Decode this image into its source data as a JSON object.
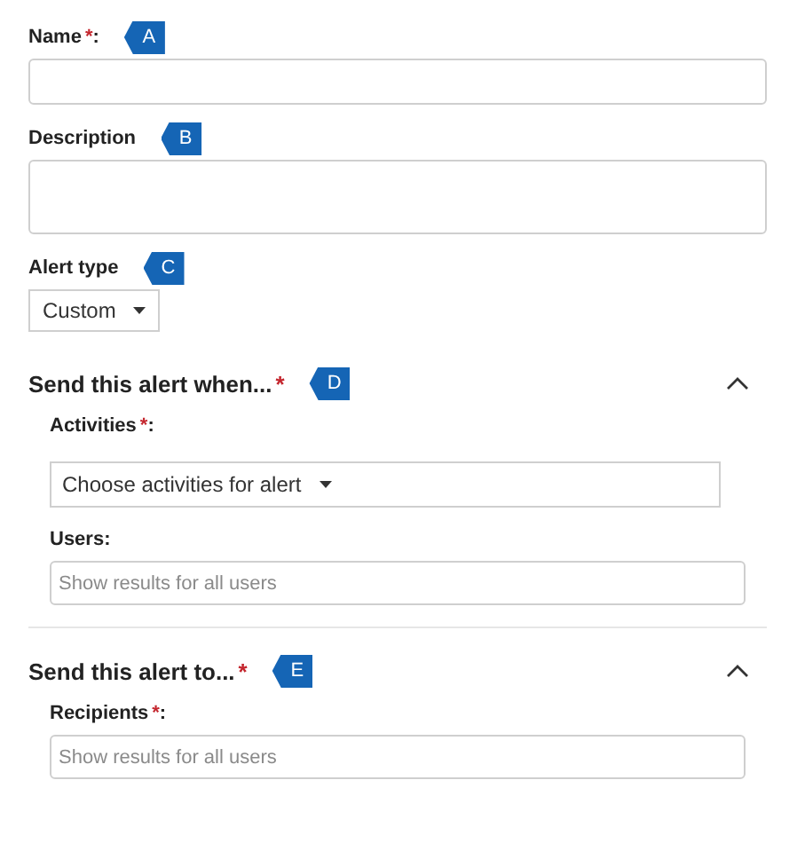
{
  "fields": [
    {
      "kind": "text",
      "label": "Name",
      "required_mark": "*",
      "suffix": ":",
      "callout": "A"
    },
    {
      "kind": "textarea",
      "label": "Description",
      "callout": "B"
    },
    {
      "kind": "select",
      "label": "Alert type",
      "value": "Custom",
      "callout": "C"
    }
  ],
  "sections": [
    {
      "title": "Send this alert when...",
      "required_mark": "*",
      "callout": "D",
      "expanded": true,
      "fields": [
        {
          "kind": "select",
          "label": "Activities",
          "required_mark": "*",
          "suffix": ":",
          "placeholder": "Choose activities for alert"
        },
        {
          "kind": "text",
          "label": "Users",
          "suffix": ":",
          "placeholder": "Show results for all users"
        }
      ]
    },
    {
      "title": "Send this alert to...",
      "required_mark": "*",
      "callout": "E",
      "expanded": true,
      "fields": [
        {
          "kind": "text",
          "label": "Recipients",
          "required_mark": "*",
          "suffix": ":",
          "placeholder": "Show results for all users"
        }
      ]
    }
  ]
}
